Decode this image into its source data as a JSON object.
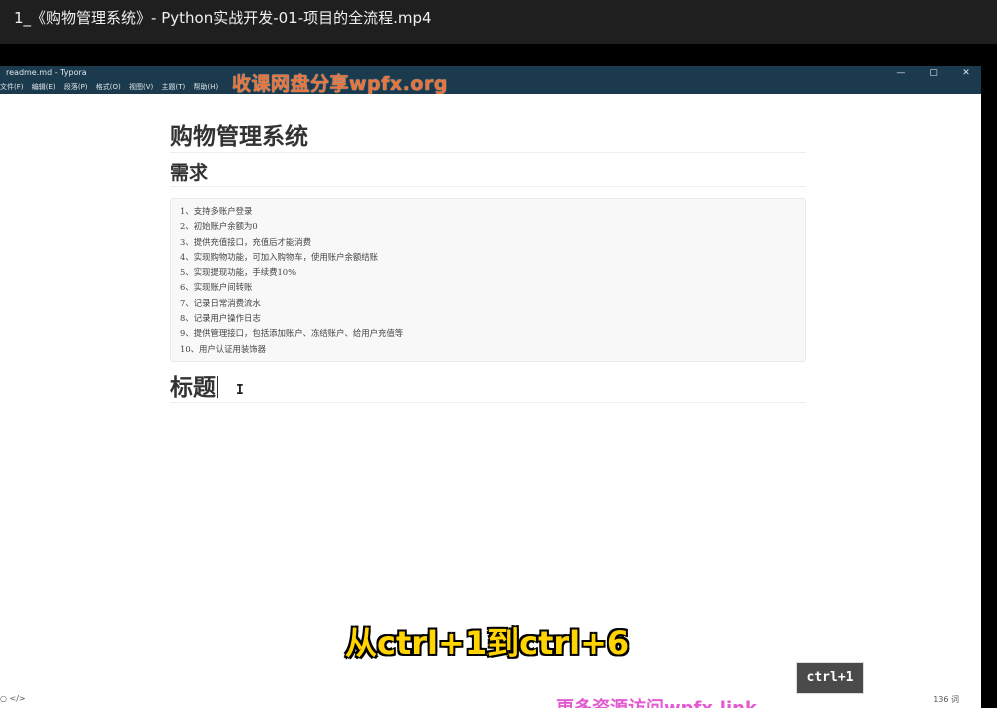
{
  "player": {
    "title": "1_《购物管理系统》- Python实战开发-01-项目的全流程.mp4"
  },
  "window": {
    "title": "readme.md - Typora",
    "controls": {
      "minimize": "—",
      "maximize": "▢",
      "close": "✕"
    }
  },
  "menu": [
    "文件(F)",
    "编辑(E)",
    "段落(P)",
    "格式(O)",
    "视图(V)",
    "主题(T)",
    "帮助(H)"
  ],
  "watermark_top": "收课网盘分享wpfx.org",
  "document": {
    "h1": "购物管理系统",
    "h2": "需求",
    "code_lines": [
      "1、支持多账户登录",
      "2、初始账户余额为0",
      "3、提供充值接口，充值后才能消费",
      "4、实现购物功能，可加入购物车，使用账户余额结账",
      "5、实现提现功能，手续费10%",
      "6、实现账户间转账",
      "7、记录日常消费流水",
      "8、记录用户操作日志",
      "9、提供管理接口，包括添加账户、冻结账户、给用户充值等",
      "10、用户认证用装饰器"
    ],
    "h1_second": "标题"
  },
  "status": {
    "left_icons": "○  </>",
    "word_count": "136 词"
  },
  "subtitle": "从ctrl+1到ctrl+6",
  "small_logo": "ctrl+1",
  "watermark_bottom": "更多资源访问wpfx.link",
  "colors": {
    "titlebar": "#1b3a4e",
    "watermark_top": "#e8743a",
    "subtitle": "#ffd400"
  }
}
